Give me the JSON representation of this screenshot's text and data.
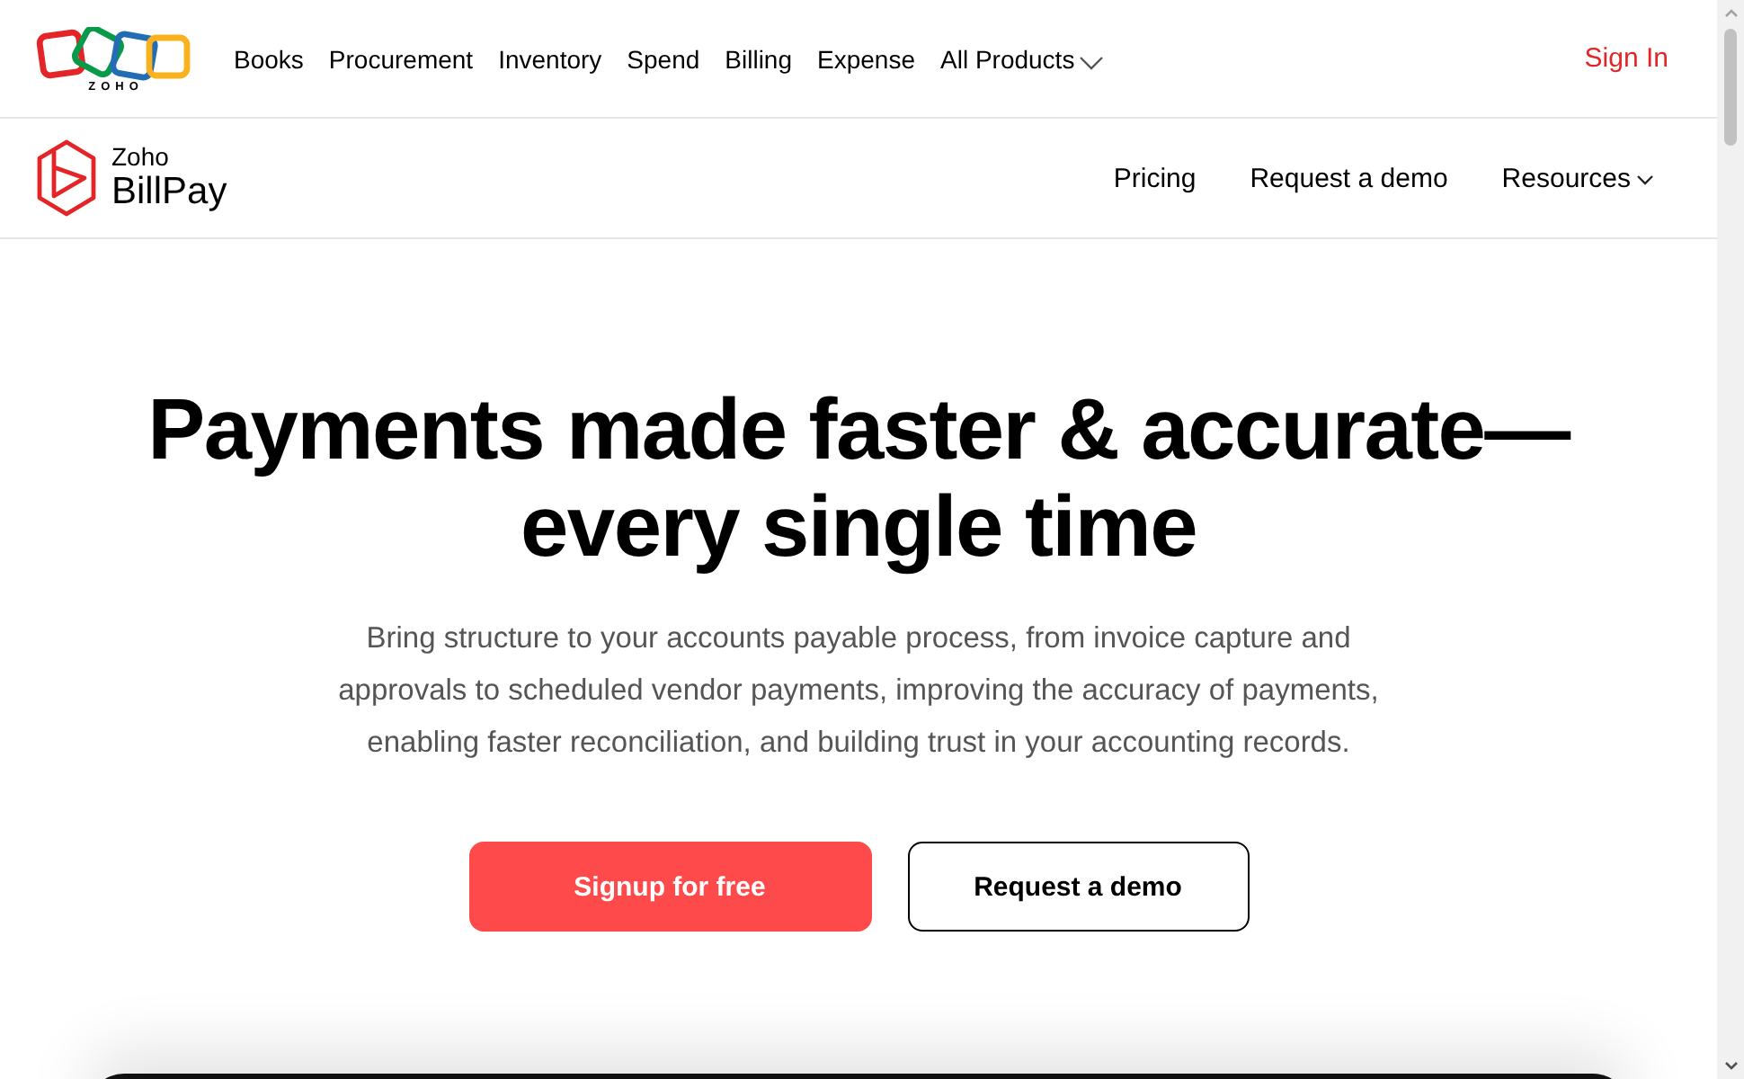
{
  "top_nav": {
    "logo_text": "ZOHO",
    "items": [
      {
        "label": "Books",
        "dropdown": false
      },
      {
        "label": "Procurement",
        "dropdown": false
      },
      {
        "label": "Inventory",
        "dropdown": false
      },
      {
        "label": "Spend",
        "dropdown": false
      },
      {
        "label": "Billing",
        "dropdown": false
      },
      {
        "label": "Expense",
        "dropdown": false
      },
      {
        "label": "All Products",
        "dropdown": true
      }
    ],
    "sign_in": "Sign In"
  },
  "product_nav": {
    "brand": "Zoho",
    "product": "BillPay",
    "items": [
      {
        "label": "Pricing",
        "dropdown": false
      },
      {
        "label": "Request a demo",
        "dropdown": false
      },
      {
        "label": "Resources",
        "dropdown": true
      }
    ]
  },
  "hero": {
    "heading": "Payments made faster & accurate—every single time",
    "description": "Bring structure to your accounts payable process, from invoice capture and approvals to scheduled vendor payments, improving the accuracy of payments, enabling faster reconciliation, and building trust in your accounting records.",
    "buttons": [
      {
        "label": "Signup for free",
        "kind": "primary"
      },
      {
        "label": "Request a demo",
        "kind": "outline"
      }
    ]
  }
}
